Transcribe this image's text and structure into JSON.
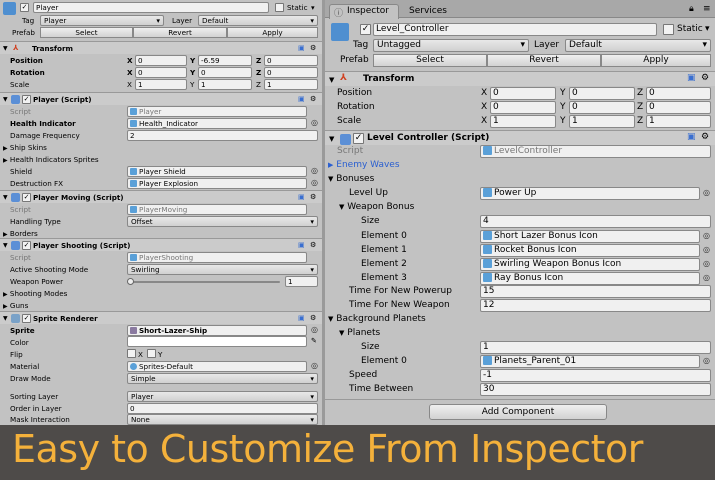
{
  "left": {
    "header": {
      "name": "Player",
      "static_label": "Static",
      "tag_label": "Tag",
      "tag_value": "Player",
      "layer_label": "Layer",
      "layer_value": "Default",
      "prefab_label": "Prefab",
      "select": "Select",
      "revert": "Revert",
      "apply": "Apply"
    },
    "transform": {
      "title": "Transform",
      "position_label": "Position",
      "rotation_label": "Rotation",
      "scale_label": "Scale",
      "position": {
        "x": "0",
        "y": "-6.59",
        "z": "0"
      },
      "rotation": {
        "x": "0",
        "y": "0",
        "z": "0"
      },
      "scale": {
        "x": "1",
        "y": "1",
        "z": "1"
      }
    },
    "player_script": {
      "title": "Player (Script)",
      "script_label": "Script",
      "script_value": "Player",
      "health_label": "Health Indicator",
      "health_value": "Health_Indicator",
      "damage_label": "Damage Frequency",
      "damage_value": "2",
      "ship_skins": "Ship Skins",
      "health_sprites": "Health Indicators Sprites",
      "shield_label": "Shield",
      "shield_value": "Player Shield",
      "destruction_label": "Destruction FX",
      "destruction_value": "Player Explosion"
    },
    "player_moving": {
      "title": "Player Moving (Script)",
      "script_label": "Script",
      "script_value": "PlayerMoving",
      "handling_label": "Handling Type",
      "handling_value": "Offset",
      "borders": "Borders"
    },
    "player_shooting": {
      "title": "Player Shooting (Script)",
      "script_label": "Script",
      "script_value": "PlayerShooting",
      "active_mode_label": "Active Shooting Mode",
      "active_mode_value": "Swirling",
      "weapon_power_label": "Weapon Power",
      "weapon_power_value": "1",
      "weapon_power_fraction": 0,
      "shooting_modes": "Shooting Modes",
      "guns": "Guns"
    },
    "sprite_renderer": {
      "title": "Sprite Renderer",
      "sprite_label": "Sprite",
      "sprite_value": "Short-Lazer-Ship",
      "color_label": "Color",
      "flip_label": "Flip",
      "flip_x": "X",
      "flip_y": "Y",
      "material_label": "Material",
      "material_value": "Sprites-Default",
      "draw_mode_label": "Draw Mode",
      "draw_mode_value": "Simple",
      "sorting_layer_label": "Sorting Layer",
      "sorting_layer_value": "Player",
      "order_label": "Order in Layer",
      "order_value": "0",
      "mask_label": "Mask Interaction",
      "mask_value": "None"
    }
  },
  "right": {
    "tabs": {
      "inspector": "Inspector",
      "services": "Services"
    },
    "header": {
      "name": "Level_Controller",
      "static_label": "Static",
      "tag_label": "Tag",
      "tag_value": "Untagged",
      "layer_label": "Layer",
      "layer_value": "Default",
      "prefab_label": "Prefab",
      "select": "Select",
      "revert": "Revert",
      "apply": "Apply"
    },
    "transform": {
      "title": "Transform",
      "position_label": "Position",
      "rotation_label": "Rotation",
      "scale_label": "Scale",
      "position": {
        "x": "0",
        "y": "0",
        "z": "0"
      },
      "rotation": {
        "x": "0",
        "y": "0",
        "z": "0"
      },
      "scale": {
        "x": "1",
        "y": "1",
        "z": "1"
      }
    },
    "level_controller": {
      "title": "Level Controller (Script)",
      "script_label": "Script",
      "script_value": "LevelController",
      "enemy_waves": "Enemy Waves",
      "bonuses": "Bonuses",
      "level_up_label": "Level Up",
      "level_up_value": "Power Up",
      "weapon_bonus": "Weapon Bonus",
      "size_label": "Size",
      "size_value": "4",
      "elements": [
        {
          "label": "Element 0",
          "value": "Short Lazer Bonus Icon"
        },
        {
          "label": "Element 1",
          "value": "Rocket Bonus Icon"
        },
        {
          "label": "Element 2",
          "value": "Swirling Weapon Bonus Icon"
        },
        {
          "label": "Element 3",
          "value": "Ray Bonus Icon"
        }
      ],
      "powerup_time_label": "Time For New Powerup",
      "powerup_time_value": "15",
      "weapon_time_label": "Time For New Weapon",
      "weapon_time_value": "12",
      "background_planets": "Background Planets",
      "planets": "Planets",
      "planets_size_label": "Size",
      "planets_size_value": "1",
      "planet_element_label": "Element 0",
      "planet_element_value": "Planets_Parent_01",
      "speed_label": "Speed",
      "speed_value": "-1",
      "time_between_label": "Time Between",
      "time_between_value": "30"
    },
    "add_component": "Add Component"
  },
  "banner": "Easy to Customize From Inspector",
  "colors": {
    "banner_bg": "#4e4b49",
    "banner_text": "#f4b13b",
    "panel_bg": "#c2c2c2",
    "link_blue": "#2a5fd0"
  }
}
